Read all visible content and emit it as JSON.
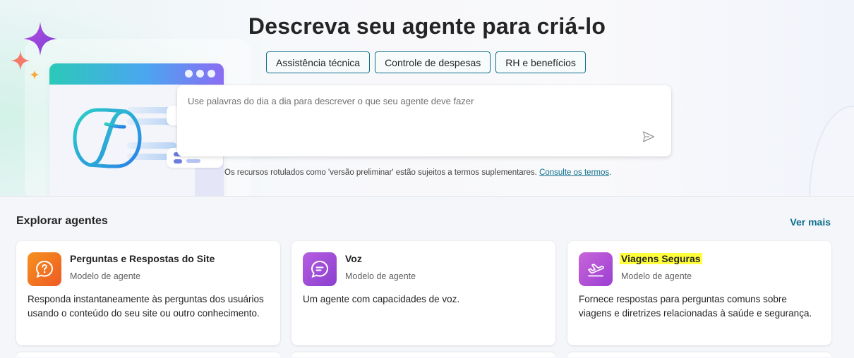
{
  "hero": {
    "title": "Descreva seu agente para criá-lo",
    "chips": [
      "Assistência técnica",
      "Controle de despesas",
      "RH e benefícios"
    ],
    "prompt_placeholder": "Use palavras do dia a dia para descrever o que seu agente deve fazer",
    "disclaimer_text": "Os recursos rotulados como 'versão preliminar' estão sujeitos a termos suplementares.",
    "disclaimer_link": "Consulte os termos",
    "disclaimer_end": "."
  },
  "explore": {
    "title": "Explorar agentes",
    "see_more": "Ver mais",
    "cards": [
      {
        "title": "Perguntas e Respostas do Site",
        "subtitle": "Modelo de agente",
        "description": "Responda instantaneamente às perguntas dos usuários usando o conteúdo do seu site ou outro conhecimento.",
        "icon": "question-chat-icon",
        "color": "#f26a1f"
      },
      {
        "title": "Voz",
        "subtitle": "Modelo de agente",
        "description": "Um agente com capacidades de voz.",
        "icon": "chat-bubble-icon",
        "color": "#9b49d6"
      },
      {
        "title": "Viagens Seguras",
        "subtitle": "Modelo de agente",
        "description": "Fornece respostas para perguntas comuns sobre viagens e diretrizes relacionadas à saúde e segurança.",
        "icon": "airplane-takeoff-icon",
        "color": "#b14ad8",
        "highlighted": true
      }
    ]
  },
  "colors": {
    "accent": "#0e6f8c",
    "highlight": "#ffff3b"
  }
}
